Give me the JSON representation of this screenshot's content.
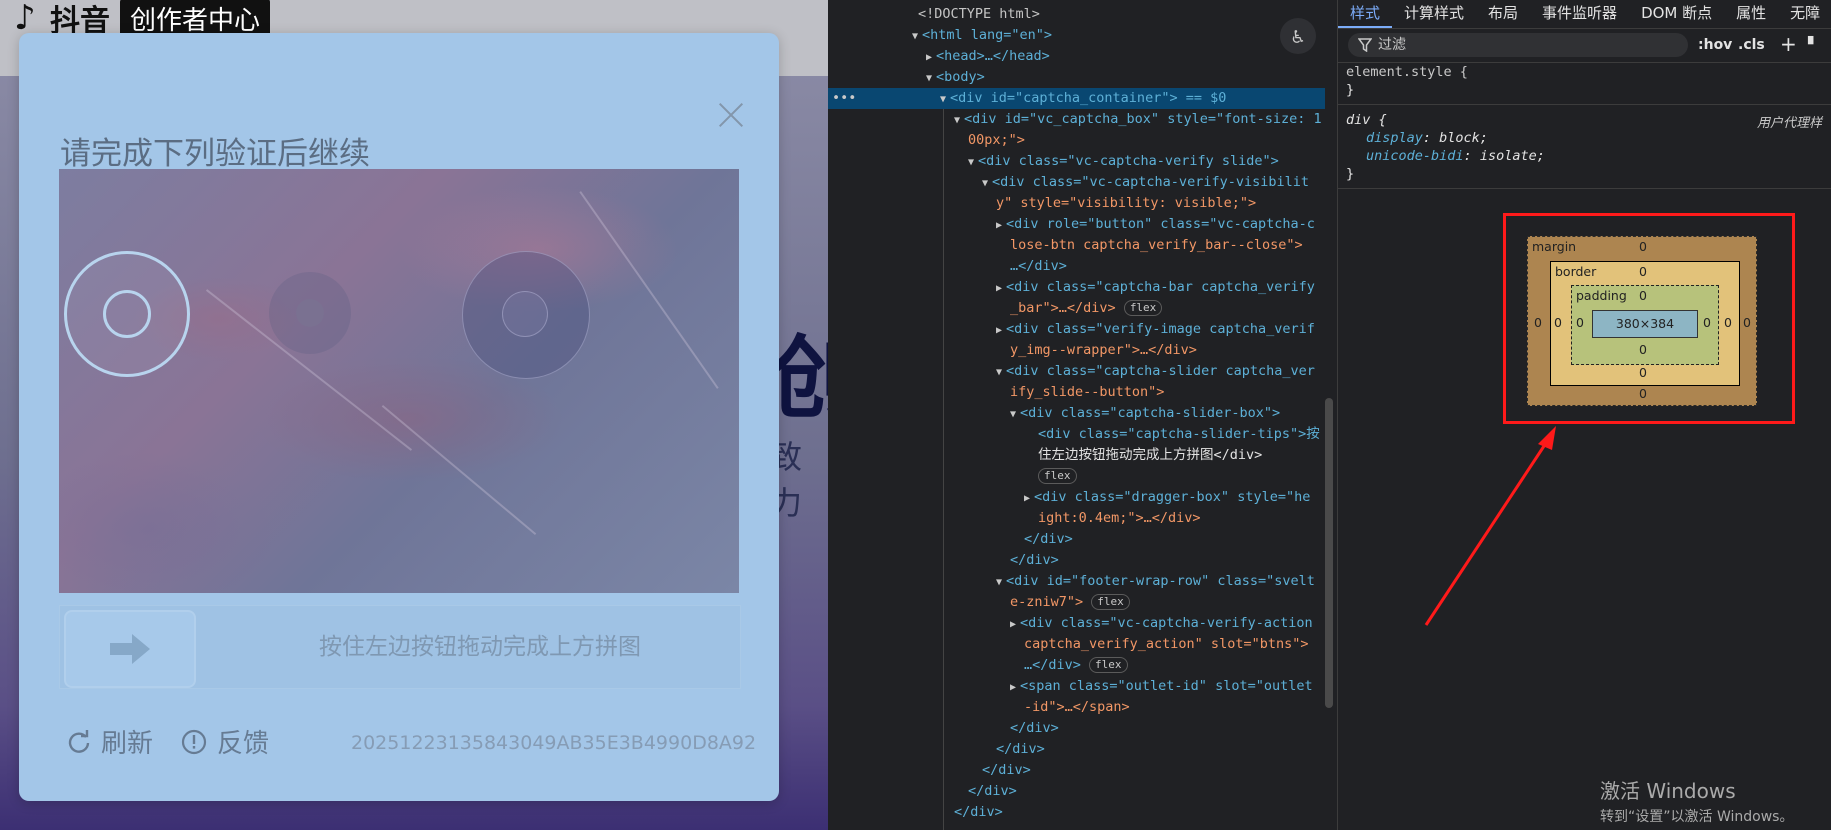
{
  "page": {
    "logo_text": "抖音",
    "logo_badge": "创作者中心",
    "bg_title_fragment": "创",
    "bg_subtitle_fragment": "致力"
  },
  "captcha": {
    "title": "请完成下列验证后继续",
    "slider_tip": "按住左边按钮拖动完成上方拼图",
    "refresh_label": "刷新",
    "feedback_label": "反馈",
    "captcha_id": "20251223135843049AB35E3B4990D8A92"
  },
  "devtools": {
    "tabs": [
      "样式",
      "计算样式",
      "布局",
      "事件监听器",
      "DOM 断点",
      "属性",
      "无障"
    ],
    "filter_placeholder": "过滤",
    "hov_label": ":hov",
    "cls_label": ".cls",
    "dom_lines": [
      {
        "t": "<!DOCTYPE html>"
      },
      {
        "t": "<html lang=\"en\">"
      },
      {
        "t": "<head>…</head>"
      },
      {
        "t": "<body>"
      },
      {
        "t": "<div id=\"captcha_container\"> == $0"
      },
      {
        "t": "<div id=\"vc_captcha_box\" style=\"font-size: 1"
      },
      {
        "t": "00px;\">"
      },
      {
        "t": "<div class=\"vc-captcha-verify slide\">"
      },
      {
        "t": "<div class=\"vc-captcha-verify-visibilit"
      },
      {
        "t": "y\" style=\"visibility: visible;\">"
      },
      {
        "t": "<div role=\"button\" class=\"vc-captcha-c"
      },
      {
        "t": "lose-btn captcha_verify_bar--close\">"
      },
      {
        "t": "…</div>"
      },
      {
        "t": "<div class=\"captcha-bar captcha_verify"
      },
      {
        "t": "_bar\">…</div>"
      },
      {
        "t": "<div class=\"verify-image captcha_verif"
      },
      {
        "t": "y_img--wrapper\">…</div>"
      },
      {
        "t": "<div class=\"captcha-slider captcha_ver"
      },
      {
        "t": "ify_slide--button\">"
      },
      {
        "t": "<div class=\"captcha-slider-box\">"
      },
      {
        "t": "<div class=\"captcha-slider-tips\">按"
      },
      {
        "t": "住左边按钮拖动完成上方拼图</div>"
      },
      {
        "t": "<div class=\"dragger-box\" style=\"he"
      },
      {
        "t": "ight:0.4em;\">…</div>"
      },
      {
        "t": "</div>"
      },
      {
        "t": "</div>"
      },
      {
        "t": "<div id=\"footer-wrap-row\" class=\"svelt"
      },
      {
        "t": "e-zniw7\">"
      },
      {
        "t": "<div class=\"vc-captcha-verify-action"
      },
      {
        "t": "captcha_verify_action\" slot=\"btns\">"
      },
      {
        "t": "…</div>"
      },
      {
        "t": "<span class=\"outlet-id\" slot=\"outlet"
      },
      {
        "t": "-id\">…</span>"
      },
      {
        "t": "</div>"
      },
      {
        "t": "</div>"
      },
      {
        "t": "</div>"
      },
      {
        "t": "</div>"
      },
      {
        "t": "</div>"
      }
    ],
    "badge_flex": "flex",
    "styles": {
      "element_style": "element.style {",
      "close_brace": "}",
      "div_selector": "div {",
      "prop1": "display",
      "val1": "block;",
      "prop2": "unicode-bidi",
      "val2": "isolate;",
      "ua_label": "用户代理样"
    },
    "box_model": {
      "margin_label": "margin",
      "border_label": "border",
      "padding_label": "padding",
      "content_size": "380×384",
      "zero": "0"
    },
    "accent_color": "#ff1a1a"
  },
  "windows": {
    "activate_title": "激活 Windows",
    "activate_sub": "转到“设置”以激活 Windows。"
  }
}
